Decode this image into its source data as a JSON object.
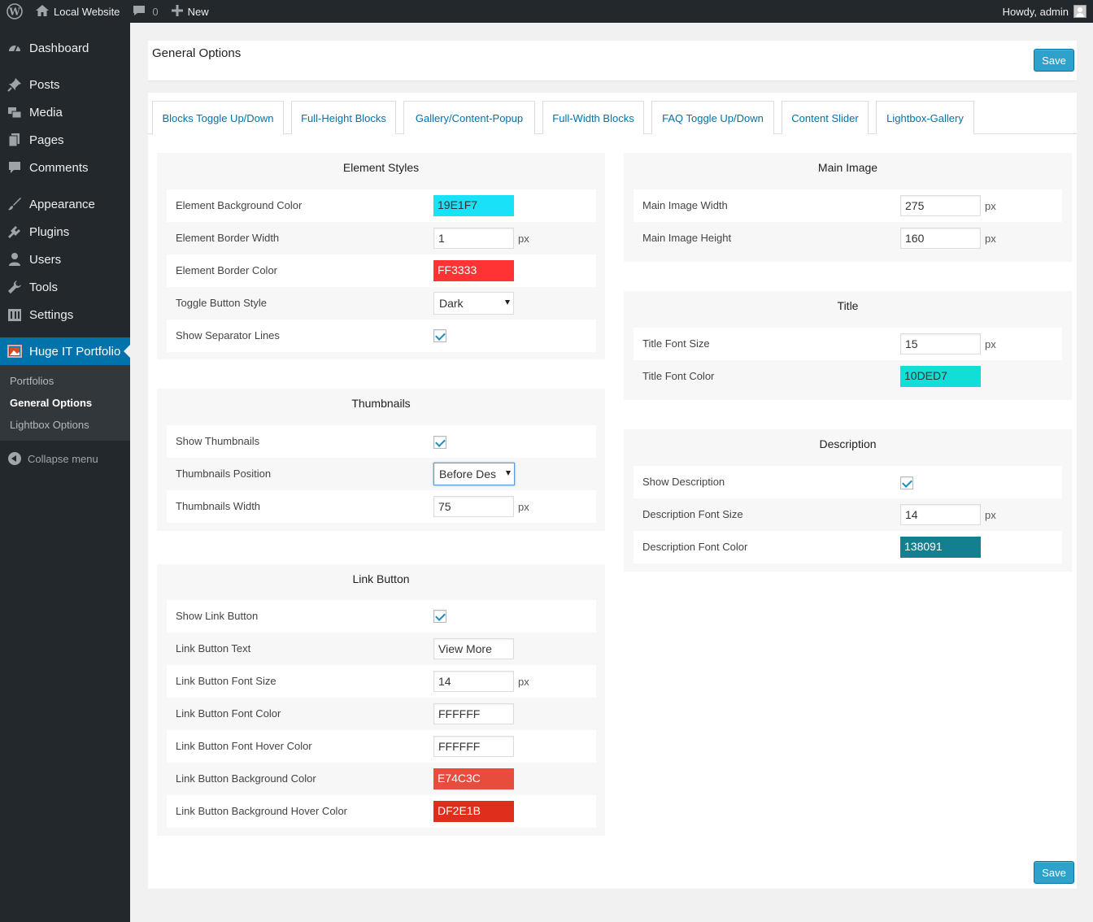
{
  "adminbar": {
    "site_name": "Local Website",
    "comments_count": "0",
    "new_label": "New",
    "howdy": "Howdy, admin"
  },
  "sidebar": {
    "items": [
      {
        "label": "Dashboard",
        "icon": "dashboard-icon"
      },
      {
        "label": "Posts",
        "icon": "pin-icon"
      },
      {
        "label": "Media",
        "icon": "media-icon"
      },
      {
        "label": "Pages",
        "icon": "pages-icon"
      },
      {
        "label": "Comments",
        "icon": "comment-icon"
      },
      {
        "label": "Appearance",
        "icon": "brush-icon"
      },
      {
        "label": "Plugins",
        "icon": "plugin-icon"
      },
      {
        "label": "Users",
        "icon": "user-icon"
      },
      {
        "label": "Tools",
        "icon": "wrench-icon"
      },
      {
        "label": "Settings",
        "icon": "settings-icon"
      },
      {
        "label": "Huge IT Portfolio",
        "icon": "portfolio-icon"
      }
    ],
    "submenu": [
      "Portfolios",
      "General Options",
      "Lightbox Options"
    ],
    "collapse": "Collapse menu"
  },
  "page": {
    "title": "General Options",
    "save_label": "Save"
  },
  "tabs": [
    "Blocks Toggle Up/Down",
    "Full-Height Blocks",
    "Gallery/Content-Popup",
    "Full-Width Blocks",
    "FAQ Toggle Up/Down",
    "Content Slider",
    "Lightbox-Gallery"
  ],
  "element_styles": {
    "title": "Element Styles",
    "bg_color_label": "Element Background Color",
    "bg_color": "19E1F7",
    "border_width_label": "Element Border Width",
    "border_width": "1",
    "border_color_label": "Element Border Color",
    "border_color": "FF3333",
    "toggle_style_label": "Toggle Button Style",
    "toggle_style": "Dark",
    "separator_label": "Show Separator Lines"
  },
  "thumbnails": {
    "title": "Thumbnails",
    "show_label": "Show Thumbnails",
    "position_label": "Thumbnails Position",
    "position": "Before Des",
    "width_label": "Thumbnails Width",
    "width": "75"
  },
  "link_button": {
    "title": "Link Button",
    "show_label": "Show Link Button",
    "text_label": "Link Button Text",
    "text": "View More",
    "font_size_label": "Link Button Font Size",
    "font_size": "14",
    "font_color_label": "Link Button Font Color",
    "font_color": "FFFFFF",
    "hover_color_label": "Link Button Font Hover Color",
    "hover_color": "FFFFFF",
    "bg_color_label": "Link Button Background Color",
    "bg_color": "E74C3C",
    "bg_hover_label": "Link Button Background Hover Color",
    "bg_hover": "DF2E1B"
  },
  "main_image": {
    "title": "Main Image",
    "width_label": "Main Image Width",
    "width": "275",
    "height_label": "Main Image Height",
    "height": "160"
  },
  "title_section": {
    "title": "Title",
    "font_size_label": "Title Font Size",
    "font_size": "15",
    "font_color_label": "Title Font Color",
    "font_color": "10DED7"
  },
  "description": {
    "title": "Description",
    "show_label": "Show Description",
    "font_size_label": "Description Font Size",
    "font_size": "14",
    "font_color_label": "Description Font Color",
    "font_color": "138091"
  },
  "unit": "px",
  "colors": {
    "admin_bg": "#23282d",
    "accent": "#0073aa",
    "button": "#2ea2cc"
  }
}
